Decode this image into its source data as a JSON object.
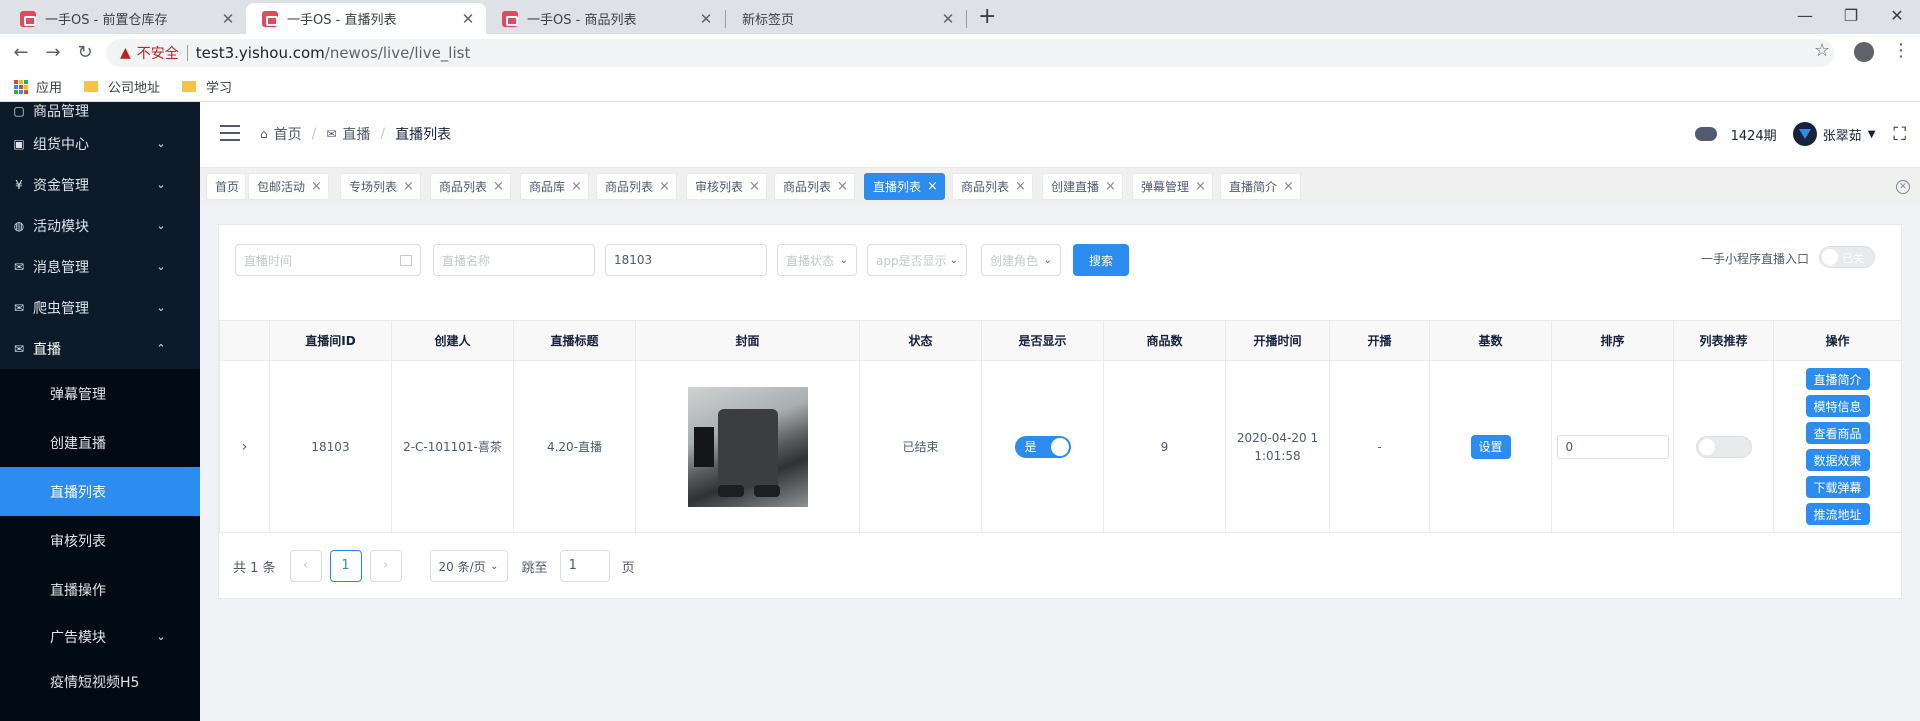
{
  "browser": {
    "tabs": [
      {
        "title": "一手OS - 前置仓库存",
        "active": false
      },
      {
        "title": "一手OS - 直播列表",
        "active": true
      },
      {
        "title": "一手OS - 商品列表",
        "active": false
      },
      {
        "title": "新标签页",
        "active": false
      }
    ],
    "insecure_label": "不安全",
    "url_host": "test3.yishou.com",
    "url_path": "/newos/live/live_list",
    "bookmarks": [
      "应用",
      "公司地址",
      "学习"
    ]
  },
  "sidebar": {
    "partial_top": "商品管理",
    "groups": [
      {
        "label": "组货中心",
        "icon": "box-icon"
      },
      {
        "label": "资金管理",
        "icon": "yen-icon"
      },
      {
        "label": "活动模块",
        "icon": "gamepad-icon"
      },
      {
        "label": "消息管理",
        "icon": "mail-icon"
      },
      {
        "label": "爬虫管理",
        "icon": "mail-icon"
      },
      {
        "label": "直播",
        "icon": "mail-icon"
      }
    ],
    "live_children": [
      "弹幕管理",
      "创建直播",
      "直播列表",
      "审核列表",
      "直播操作"
    ],
    "after": [
      {
        "label": "广告模块",
        "has_chevron": true
      },
      {
        "label": "疫情短视频H5",
        "has_chevron": false
      }
    ]
  },
  "header": {
    "breadcrumb": [
      "首页",
      "直播",
      "直播列表"
    ],
    "period": "1424期",
    "username": "张翠茹"
  },
  "tags": [
    "首页",
    "包邮活动",
    "专场列表",
    "商品列表",
    "商品库",
    "商品列表",
    "审核列表",
    "商品列表",
    "直播列表",
    "商品列表",
    "创建直播",
    "弹幕管理",
    "直播简介"
  ],
  "active_tag_index": 8,
  "filters": {
    "time_placeholder": "直播时间",
    "name_placeholder": "直播名称",
    "room_id_value": "18103",
    "status_placeholder": "直播状态",
    "app_show_placeholder": "app是否显示",
    "role_placeholder": "创建角色",
    "search_label": "搜索",
    "entry_label": "一手小程序直播入口",
    "entry_state": "已关"
  },
  "table": {
    "columns": [
      "",
      "直播间ID",
      "创建人",
      "直播标题",
      "封面",
      "状态",
      "是否显示",
      "商品数",
      "开播时间",
      "开播",
      "基数",
      "排序",
      "列表推荐",
      "操作"
    ],
    "rows": [
      {
        "room_id": "18103",
        "creator": "2-C-101101-喜茶",
        "title": "4.20-直播",
        "status": "已结束",
        "show_label": "是",
        "show_on": true,
        "goods_count": "9",
        "start_time": "2020-04-20 11:01:58",
        "live": "-",
        "base_label": "设置",
        "sort": "0",
        "recommend_on": false,
        "ops": [
          "直播简介",
          "模特信息",
          "查看商品",
          "数据效果",
          "下载弹幕",
          "推流地址"
        ]
      }
    ]
  },
  "pager": {
    "total": "共 1 条",
    "current": "1",
    "page_size": "20 条/页",
    "jump_label": "跳至",
    "jump_value": "1",
    "page_unit": "页"
  }
}
